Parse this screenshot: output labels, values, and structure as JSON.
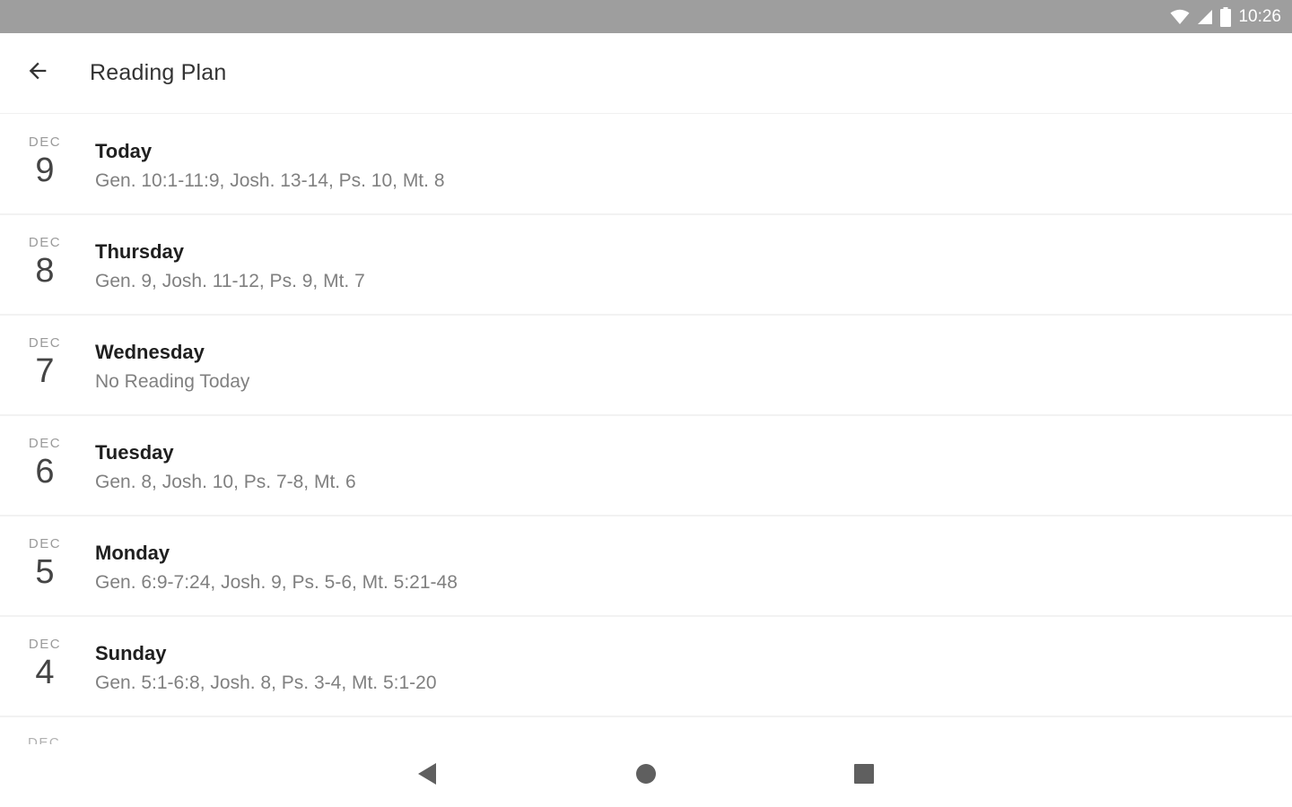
{
  "status_bar": {
    "time": "10:26",
    "icons": [
      "wifi-icon",
      "cell-signal-icon",
      "battery-icon"
    ]
  },
  "app_bar": {
    "title": "Reading Plan",
    "back_icon": "arrow-back-icon"
  },
  "plan": {
    "items": [
      {
        "month": "DEC",
        "day": "9",
        "label": "Today",
        "readings": "Gen. 10:1-11:9, Josh. 13-14, Ps. 10, Mt. 8"
      },
      {
        "month": "DEC",
        "day": "8",
        "label": "Thursday",
        "readings": "Gen. 9, Josh. 11-12, Ps. 9, Mt. 7"
      },
      {
        "month": "DEC",
        "day": "7",
        "label": "Wednesday",
        "readings": "No Reading Today"
      },
      {
        "month": "DEC",
        "day": "6",
        "label": "Tuesday",
        "readings": "Gen. 8, Josh. 10, Ps. 7-8, Mt. 6"
      },
      {
        "month": "DEC",
        "day": "5",
        "label": "Monday",
        "readings": "Gen. 6:9-7:24, Josh. 9, Ps. 5-6, Mt. 5:21-48"
      },
      {
        "month": "DEC",
        "day": "4",
        "label": "Sunday",
        "readings": "Gen. 5:1-6:8, Josh. 8, Ps. 3-4, Mt. 5:1-20"
      }
    ],
    "partial_item_month": "DEC"
  },
  "nav_bar": {
    "icons": [
      "nav-back-icon",
      "nav-home-icon",
      "nav-recents-icon"
    ]
  },
  "colors": {
    "status_bar": "#9e9e9e",
    "background": "#ffffff",
    "primary_text": "#1f1f1f",
    "secondary_text": "#808080",
    "divider": "#f2f2f2"
  }
}
